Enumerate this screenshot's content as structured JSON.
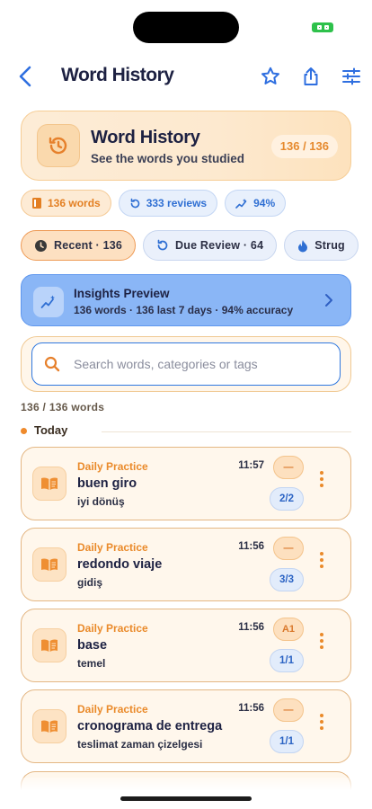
{
  "nav": {
    "title": "Word History"
  },
  "hero": {
    "title": "Word History",
    "subtitle": "See the words you studied",
    "badge": "136 / 136"
  },
  "stats": [
    {
      "label": "136 words",
      "icon": "book-icon",
      "tone": "orange"
    },
    {
      "label": "333 reviews",
      "icon": "refresh-icon",
      "tone": "blue"
    },
    {
      "label": "94%",
      "icon": "sparkle-icon",
      "tone": "blue"
    }
  ],
  "filters": [
    {
      "label": "Recent · 136",
      "icon": "history-icon",
      "active": true
    },
    {
      "label": "Due Review · 64",
      "icon": "refresh-icon",
      "active": false
    },
    {
      "label": "Strug",
      "icon": "flame-icon",
      "active": false
    }
  ],
  "insights": {
    "title": "Insights Preview",
    "subtitle": "136 words · 136 last 7 days · 94% accuracy"
  },
  "search": {
    "placeholder": "Search words, categories or tags",
    "value": ""
  },
  "result_count": "136 / 136 words",
  "section": {
    "label": "Today"
  },
  "entries": [
    {
      "category": "Daily Practice",
      "time": "11:57",
      "word": "buen giro",
      "translation": "iyi dönüş",
      "level": "—",
      "reviews": "2/2"
    },
    {
      "category": "Daily Practice",
      "time": "11:56",
      "word": "redondo viaje",
      "translation": "gidiş",
      "level": "—",
      "reviews": "3/3"
    },
    {
      "category": "Daily Practice",
      "time": "11:56",
      "word": "base",
      "translation": "temel",
      "level": "A1",
      "reviews": "1/1"
    },
    {
      "category": "Daily Practice",
      "time": "11:56",
      "word": "cronograma de entrega",
      "translation": "teslimat zaman çizelgesi",
      "level": "—",
      "reviews": "1/1"
    }
  ],
  "colors": {
    "accent": "#ea8a2a",
    "blue": "#2f78e0",
    "status": "#2ec14b"
  }
}
